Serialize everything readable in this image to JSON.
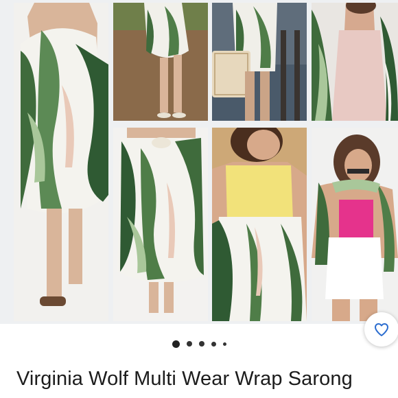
{
  "listing": {
    "title": "Virginia Wolf Multi Wear Wrap Sarong"
  },
  "carousel": {
    "active_index": 0,
    "dot_count": 5
  },
  "colors": {
    "accent": "#2a6ccf",
    "leaf_green": "#3f6b3c",
    "text": "#1c1c1c"
  },
  "icons": {
    "favorite": "heart-icon"
  }
}
